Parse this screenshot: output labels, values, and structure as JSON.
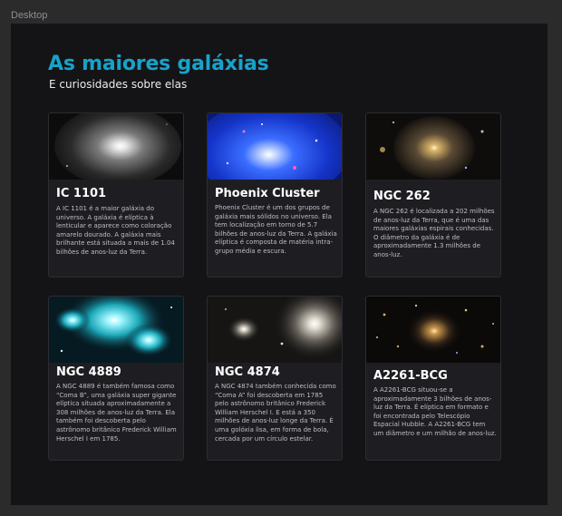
{
  "window": {
    "label": "Desktop"
  },
  "page": {
    "title": "As maiores galáxias",
    "subtitle": "E curiosidades sobre elas"
  },
  "cards": [
    {
      "name": "IC 1101",
      "description": "A IC 1101 é a maior galáxia do universo. A galáxia é elíptica à lenticular e aparece como coloração amarelo dourado. A galáxia mais brilhante está situada a mais de 1.04 bilhões de anos-luz da Terra."
    },
    {
      "name": "Phoenix Cluster",
      "description": "Phoenix Cluster é um dos grupos de galáxia mais sólidos no universo. Ela tem localização em torno de 5.7 bilhões de anos-luz da Terra. A galáxia elíptica é composta de matéria intra-grupo média e escura."
    },
    {
      "name": "NGC 262",
      "description": "A NGC 262 é localizada a 202 milhões de anos-luz da Terra, que é uma das maiores galáxias espirais conhecidas. O diâmetro da galáxia é de aproximadamente 1.3 milhões de anos-luz."
    },
    {
      "name": "NGC 4889",
      "description": "A NGC 4889 é também famosa como “Coma B”, uma galáxia super gigante elíptica situada aproximadamente a 308 milhões de anos-luz da Terra. Ela também foi descoberta pelo astrônomo britânico Frederick William Herschel I em 1785."
    },
    {
      "name": "NGC 4874",
      "description": "A NGC 4874 também conhecida como “Coma A” foi descoberta em 1785 pelo astrônomo britânico Frederick William Herschel I. E está a 350 milhões de anos-luz longe da Terra. É uma golóxia lisa, em forma de bola, cercada por um círculo estelar."
    },
    {
      "name": "A2261-BCG",
      "description": "A A2261-BCG situou-se a aproximadamente 3 bilhões de anos-luz da Terra. É elíptica em formato e foi encontrada pelo Telescópio Espacial Hubble. A A2261-BCG tem um diâmetro e um milhão de anos-luz."
    }
  ]
}
